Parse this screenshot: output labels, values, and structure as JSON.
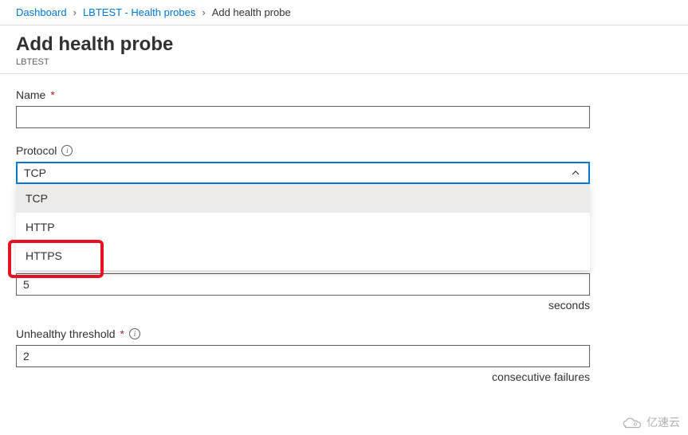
{
  "breadcrumb": {
    "items": [
      {
        "label": "Dashboard",
        "link": true
      },
      {
        "label": "LBTEST - Health probes",
        "link": true
      },
      {
        "label": "Add health probe",
        "link": false
      }
    ]
  },
  "header": {
    "title": "Add health probe",
    "subtitle": "LBTEST"
  },
  "fields": {
    "name": {
      "label": "Name",
      "value": ""
    },
    "protocol": {
      "label": "Protocol",
      "selected": "TCP",
      "options": [
        "TCP",
        "HTTP",
        "HTTPS"
      ]
    },
    "interval": {
      "value": "5",
      "unit": "seconds"
    },
    "threshold": {
      "label": "Unhealthy threshold",
      "value": "2",
      "unit": "consecutive failures"
    }
  },
  "watermark": "亿速云"
}
